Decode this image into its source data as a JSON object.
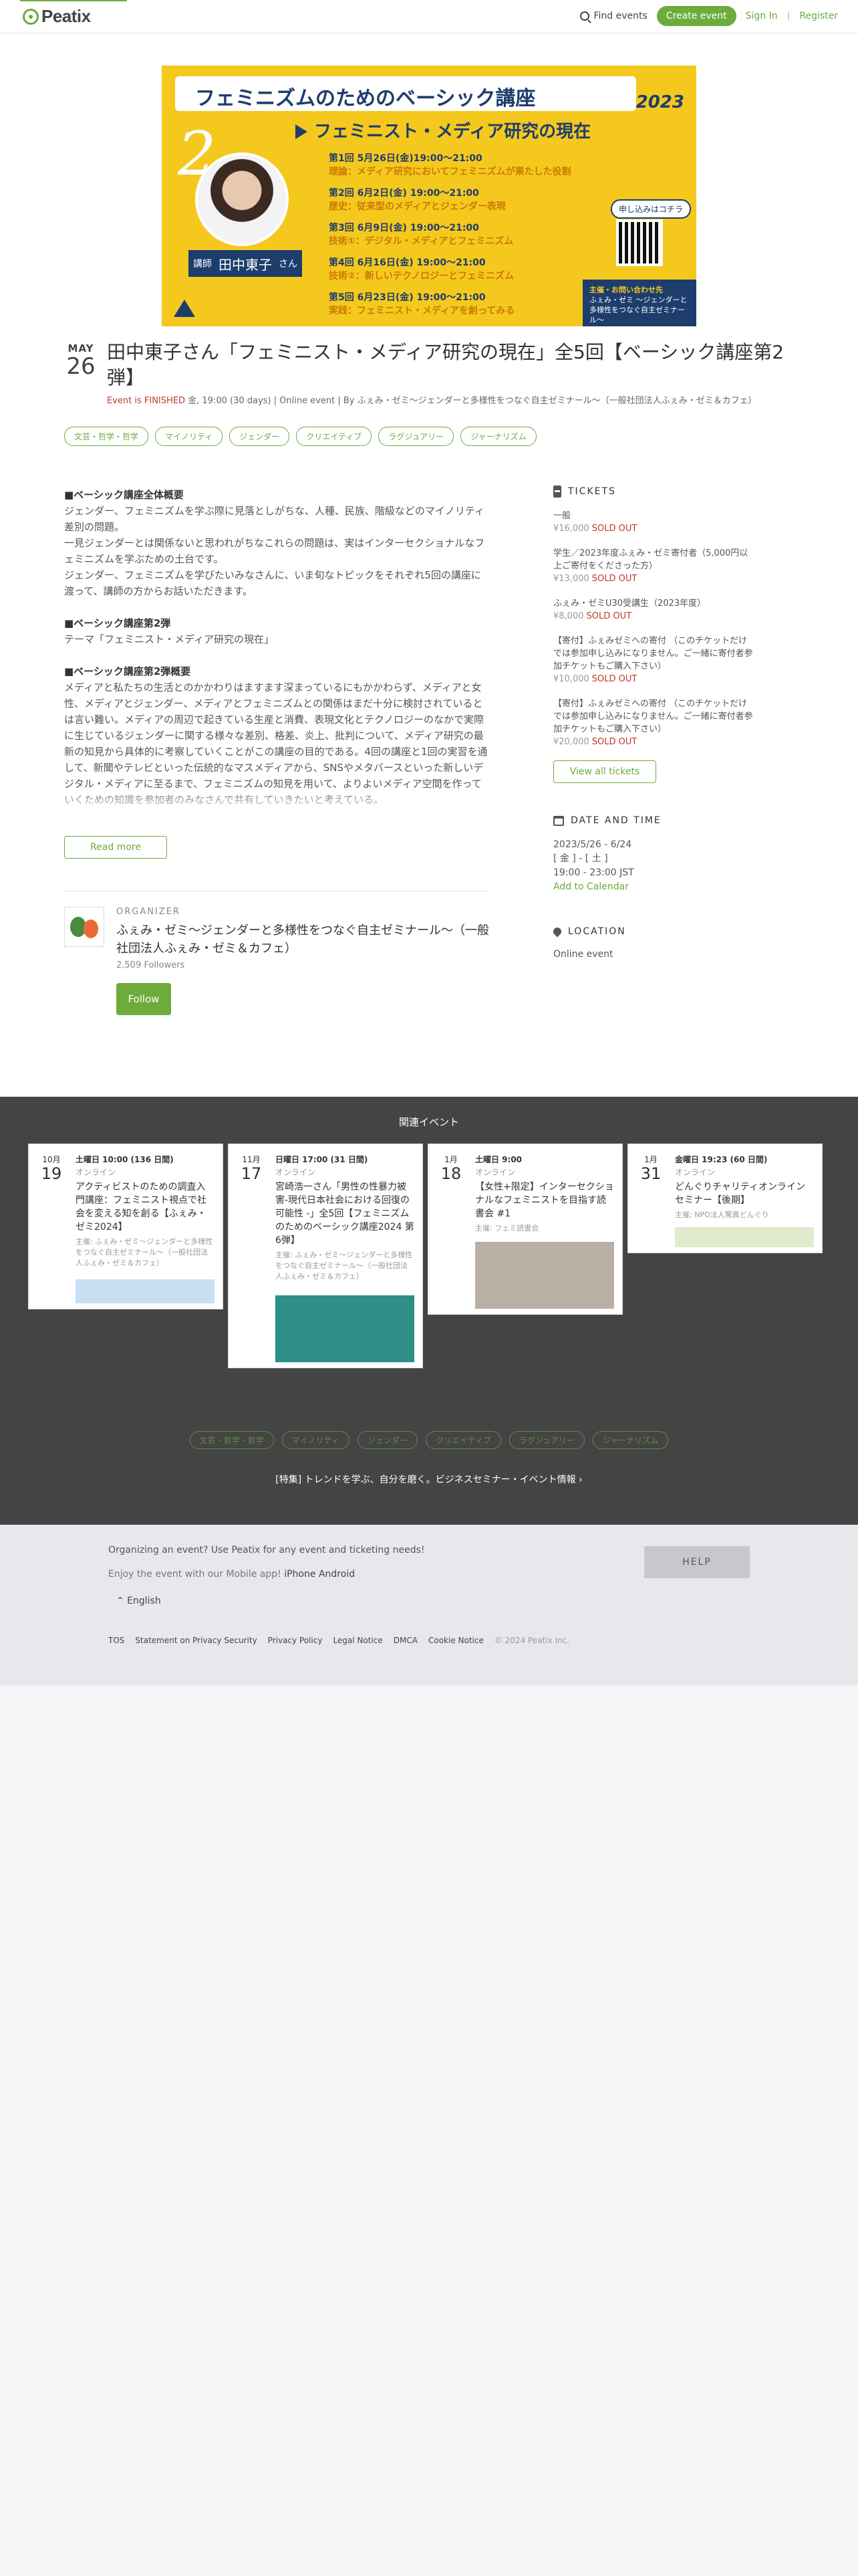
{
  "header": {
    "logo": "Peatix",
    "find_events": "Find events",
    "create_event": "Create event",
    "sign_in": "Sign In",
    "separator": "|",
    "register": "Register"
  },
  "banner": {
    "title": "フェミニズムのためのベーシック講座",
    "year": "2023",
    "number": "2",
    "subject": "フェミニスト・メディア研究の現在",
    "lecturer_label": "講師",
    "lecturer_name": "田中東子",
    "lecturer_suffix": "さん",
    "apply": "申し込みはコチラ",
    "sessions": [
      {
        "date": "第1回 5月26日(金)19:00〜21:00",
        "topic": "理論：メディア研究においてフェミニズムが果たした役割"
      },
      {
        "date": "第2回 6月2日(金) 19:00〜21:00",
        "topic": "歴史：従来型のメディアとジェンダー表現"
      },
      {
        "date": "第3回 6月9日(金) 19:00〜21:00",
        "topic": "技術①：デジタル・メディアとフェミニズム"
      },
      {
        "date": "第4回 6月16日(金) 19:00〜21:00",
        "topic": "技術②：新しいテクノロジーとフェミニズム"
      },
      {
        "date": "第5回 6月23日(金) 19:00〜21:00",
        "topic": "実践：フェミニスト・メディアを創ってみる"
      }
    ],
    "contact_head": "主催・お問い合わせ先",
    "contact_body": "ふぇみ・ゼミ 〜ジェンダーと多様性をつなぐ自主ゼミナール〜"
  },
  "event": {
    "month": "MAY",
    "day": "26",
    "title": "田中東子さん「フェミニスト・メディア研究の現在」全5回【ベーシック講座第2弾】",
    "status": "Event is FINISHED",
    "meta": " 金, 19:00 (30 days) | Online event | By ふぇみ・ゼミ〜ジェンダーと多様性をつなぐ自主ゼミナール〜（一般社団法人ふぇみ・ゼミ＆カフェ）",
    "tags": [
      "文芸・哲学・哲学",
      "マイノリティ",
      "ジェンダー",
      "クリエイティブ",
      "ラグジュアリー",
      "ジャーナリズム"
    ]
  },
  "description": {
    "h1": "■ベーシック講座全体概要",
    "p1": "ジェンダー、フェミニズムを学ぶ際に見落としがちな、人種、民族、階級などのマイノリティ差別の問題。",
    "p2": "一見ジェンダーとは関係ないと思われがちなこれらの問題は、実はインターセクショナルなフェミニズムを学ぶための土台です。",
    "p3": "ジェンダー、フェミニズムを学びたいみなさんに、いま旬なトピックをそれぞれ5回の講座に渡って、講師の方からお話いただきます。",
    "h2": "■ベーシック講座第2弾",
    "p4": "テーマ「フェミニスト・メディア研究の現在」",
    "h3": "■ベーシック講座第2弾概要",
    "p5": "メディアと私たちの生活とのかかわりはますます深まっているにもかかわらず、メディアと女性、メディアとジェンダー、メディアとフェミニズムとの関係はまだ十分に検討されているとは言い難い。メディアの周辺で起きている生産と消費、表現文化とテクノロジーのなかで実際に生じているジェンダーに関する様々な差別、格差、炎上、批判について、メディア研究の最新の知見から具体的に考察していくことがこの講座の目的である。4回の講座と1回の実習を通して、新聞やテレビといった伝統的なマスメディアから、SNSやメタバースといった新しいデジタル・メディアに至るまで、フェミニズムの知見を用いて、よりよいメディア空間を作っていくための知識を参加者のみなさんで共有していきたいと考えている。",
    "read_more": "Read more"
  },
  "organizer": {
    "label": "ORGANIZER",
    "name": "ふぇみ・ゼミ〜ジェンダーと多様性をつなぐ自主ゼミナール〜（一般社団法人ふぇみ・ゼミ＆カフェ）",
    "followers": "2,509 Followers",
    "follow": "Follow"
  },
  "tickets": {
    "heading": "TICKETS",
    "items": [
      {
        "name": "一般",
        "price": "¥16,000",
        "status": "SOLD OUT"
      },
      {
        "name": "学生／2023年度ふぇみ・ゼミ寄付者（5,000円以上ご寄付をくださった方）",
        "price": "¥13,000",
        "status": "SOLD OUT"
      },
      {
        "name": "ふぇみ・ゼミU30受講生（2023年度）",
        "price": "¥8,000",
        "status": "SOLD OUT"
      },
      {
        "name": "【寄付】ふぇみゼミへの寄付 （このチケットだけでは参加申し込みになりません。ご一緒に寄付者参加チケットもご購入下さい）",
        "price": "¥10,000",
        "status": "SOLD OUT"
      },
      {
        "name": "【寄付】ふぇみゼミへの寄付 （このチケットだけでは参加申し込みになりません。ご一緒に寄付者参加チケットもご購入下さい）",
        "price": "¥20,000",
        "status": "SOLD OUT"
      }
    ],
    "view_all": "View all tickets"
  },
  "datetime": {
    "heading": "DATE AND TIME",
    "range": "2023/5/26 - 6/24",
    "days": "[ 金 ] - [ 土 ]",
    "time": "19:00 - 23:00 JST",
    "add_calendar": "Add to Calendar"
  },
  "location": {
    "heading": "LOCATION",
    "value": "Online event"
  },
  "related": {
    "title": "関連イベント",
    "cards": [
      {
        "month": "10月",
        "day": "19",
        "time": "土曜日 10:00 (136 日間)",
        "online": "オンライン",
        "title": "アクティビストのための調査入門講座：フェミニスト視点で社会を変える知を創る【ふぇみ・ゼミ2024】",
        "org": "主催: ふぇみ・ゼミ〜ジェンダーと多様性をつなぐ自主ゼミナール〜（一般社団法人ふぇみ・ゼミ＆カフェ）",
        "img": "#c9dff3"
      },
      {
        "month": "11月",
        "day": "17",
        "time": "日曜日 17:00 (31 日間)",
        "online": "オンライン",
        "title": "宮崎浩一さん「男性の性暴力被害-現代日本社会における回復の可能性 -」全5回【フェミニズムのためのベーシック講座2024 第6弾】",
        "org": "主催: ふぇみ・ゼミ〜ジェンダーと多様性をつなぐ自主ゼミナール〜（一般社団法人ふぇみ・ゼミ＆カフェ）",
        "img": "#2d8f86"
      },
      {
        "month": "1月",
        "day": "18",
        "time": "土曜日 9:00",
        "online": "オンライン",
        "title": "【女性+限定】インターセクショナルなフェミニストを目指す読書会 #1",
        "org": "主催: フェミ読書会",
        "img": "#b8b0a4"
      },
      {
        "month": "1月",
        "day": "31",
        "time": "金曜日 19:23 (60 日間)",
        "online": "オンライン",
        "title": "どんぐりチャリティオンラインセミナー【後期】",
        "org": "主催: NPO法人驚異どんぐり",
        "img": "#dfeccd"
      }
    ]
  },
  "footer_tags": [
    "文芸・哲学・哲学",
    "マイノリティ",
    "ジェンダー",
    "クリエイティブ",
    "ラグジュアリー",
    "ジャーナリズム"
  ],
  "feature": "[特集] トレンドを学ぶ、自分を磨く。ビジネスセミナー・イベント情報 ›",
  "footer": {
    "organizing": "Organizing an event? Use Peatix for any event and ticketing needs!",
    "enjoy": "Enjoy the event with our Mobile app!",
    "iphone": "iPhone",
    "android": "Android",
    "language": "⌃ English",
    "help": "HELP",
    "links": [
      "TOS",
      "Statement on Privacy Security",
      "Privacy Policy",
      "Legal Notice",
      "DMCA",
      "Cookie Notice"
    ],
    "copyright": "© 2024 Peatix Inc."
  }
}
